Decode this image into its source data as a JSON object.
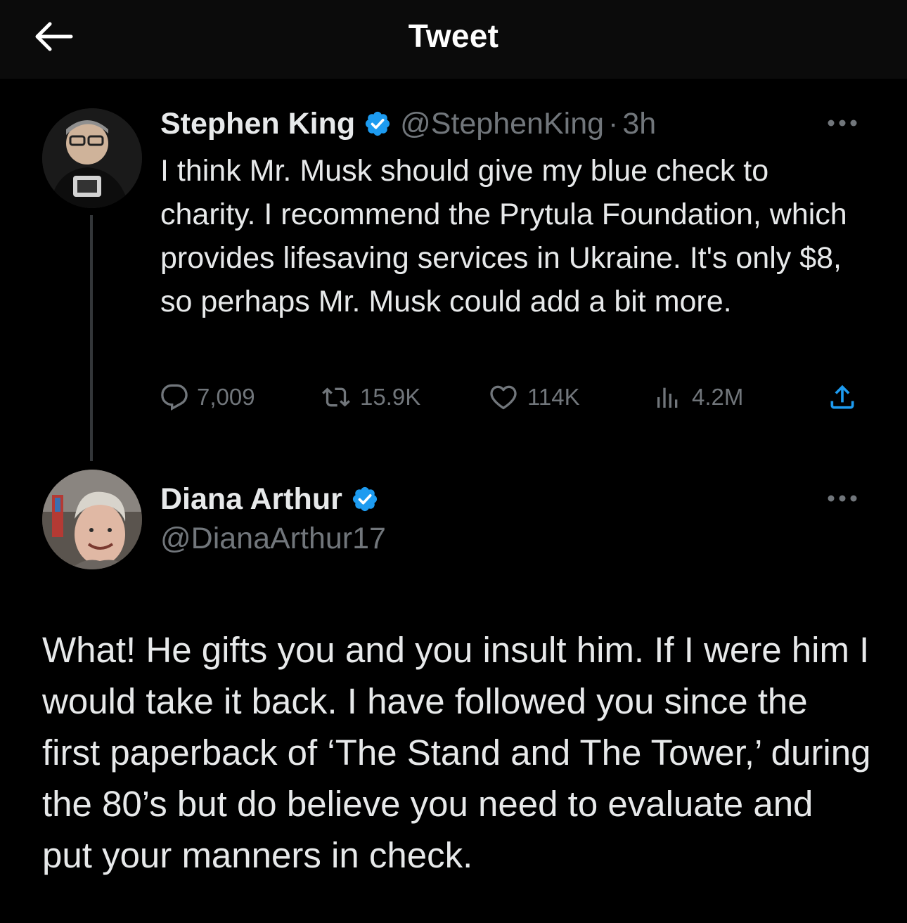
{
  "header": {
    "title": "Tweet",
    "back_icon": "arrow-left-icon"
  },
  "original_tweet": {
    "author_name": "Stephen King",
    "author_handle": "@StephenKing",
    "time": "3h",
    "verified": true,
    "text": "I think Mr. Musk should give my blue check to charity. I recommend the Prytula Foundation, which provides lifesaving services in Ukraine. It's only $8, so perhaps Mr. Musk could add a bit more.",
    "stats": {
      "replies": "7,009",
      "retweets": "15.9K",
      "likes": "114K",
      "views": "4.2M"
    }
  },
  "reply_tweet": {
    "author_name": "Diana Arthur",
    "author_handle": "@DianaArthur17",
    "verified": true,
    "text": "What! He gifts you and you insult him. If I were him I would take it back. I have followed you since the first paperback of ‘The Stand and The Tower,’ during the 80’s but do believe you need to evaluate and put your manners in check."
  },
  "colors": {
    "background": "#000000",
    "header_background": "#0b0b0b",
    "text_primary": "#e7e9ea",
    "text_secondary": "#71767b",
    "verified_blue": "#1d9bf0",
    "thread_line": "#333639"
  }
}
